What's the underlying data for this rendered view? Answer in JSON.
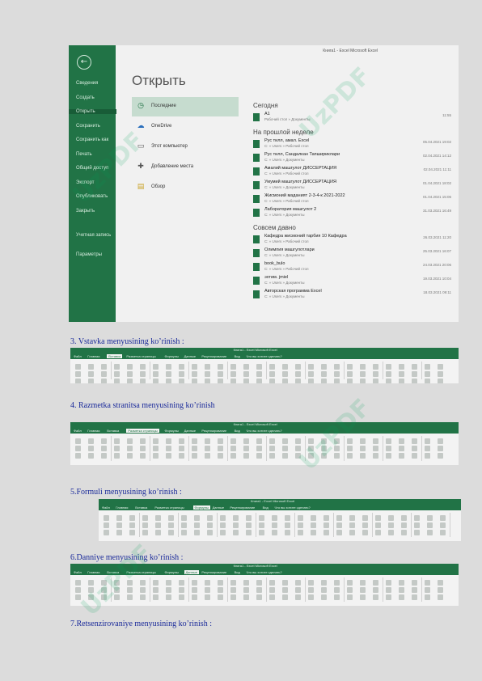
{
  "open_screen": {
    "window_title": "Книга1 - Excel Microsoft Excel",
    "title": "Открыть",
    "sidebar": [
      "Сведения",
      "Создать",
      "Открыть",
      "Сохранить",
      "Сохранить как",
      "Печать",
      "Общий доступ",
      "Экспорт",
      "Опубликовать",
      "Закрыть",
      "Учетная запись",
      "Параметры"
    ],
    "active_sidebar": "Открыть",
    "places": [
      "Последние",
      "OneDrive",
      "Этот компьютер",
      "Добавление места",
      "Обзор"
    ],
    "sections": [
      {
        "header": "Сегодня",
        "items": [
          {
            "name": "A1",
            "path": "Рабочий стол » Документы",
            "date": "11:55"
          }
        ]
      },
      {
        "header": "На прошлой неделе",
        "items": [
          {
            "name": "Рус тилл, амал. Excel",
            "path": "C: » Users » Рабочий стол",
            "date": "05.04.2021 19:02"
          },
          {
            "name": "Рус тилл, Сандалкан Тапшириклари",
            "path": "C: » Users » Документы",
            "date": "02.04.2021 14:12"
          },
          {
            "name": "Амалий машгулот ДИССЕРТАЦИЯ",
            "path": "C: » Users » Рабочий стол",
            "date": "02.04.2021 11:11"
          },
          {
            "name": "Умумий машгулот ДИССЕРТАЦИЯ",
            "path": "C: » Users » Документы",
            "date": "01.04.2021 18:02"
          },
          {
            "name": "Жисмоний маданият 2-3-4-к 2021-2022",
            "path": "C: » Users » Рабочий стол",
            "date": "01.04.2021 15:06"
          },
          {
            "name": "Лаборатория машгулот 2",
            "path": "C: » Users » Документы",
            "date": "31.03.2021 16:49"
          }
        ]
      },
      {
        "header": "Совсем давно",
        "items": [
          {
            "name": "Кафедра жисмоний тарбия 10 Кафедра",
            "path": "C: » Users » Рабочий стол",
            "date": "26.03.2021 11:20"
          },
          {
            "name": "Олимпия машгулотлари",
            "path": "C: » Users » Документы",
            "date": "25.03.2021 16:07"
          },
          {
            "name": "book_bulo",
            "path": "C: » Users » Рабочий стол",
            "date": "24.03.2021 20:06"
          },
          {
            "name": "эхтим. jmiel",
            "path": "C: » Users » Документы",
            "date": "19.03.2021 10:04"
          },
          {
            "name": "Авторская программа Excel",
            "path": "C: » Users » Документы",
            "date": "18.03.2021 09:11"
          }
        ]
      }
    ]
  },
  "captions": [
    "3. Vstavka menyusining ko’rinish :",
    "4. Razmetka stranitsa menyusining ko’rinish",
    "5.Formuli  menyusining ko’rinish :",
    "6.Danniye  menyusining ko’rinish :",
    "7.Retsenzirovaniye  menyusining ko’rinish :"
  ],
  "ribbons": [
    {
      "active": 2
    },
    {
      "active": 3
    },
    {
      "active": 4
    },
    {
      "active": 5
    }
  ],
  "ribbon_title": "Книга1 - Excel Microsoft Excel",
  "ribbon_tabs": [
    "Файл",
    "Главная",
    "Вставка",
    "Разметка страницы",
    "Формулы",
    "Данные",
    "Рецензирование",
    "Вид",
    "Что вы хотите сделать?"
  ],
  "watermark": "UzPDF",
  "colors": {
    "excel_green": "#217346",
    "caption_blue": "#1a2a9a"
  }
}
